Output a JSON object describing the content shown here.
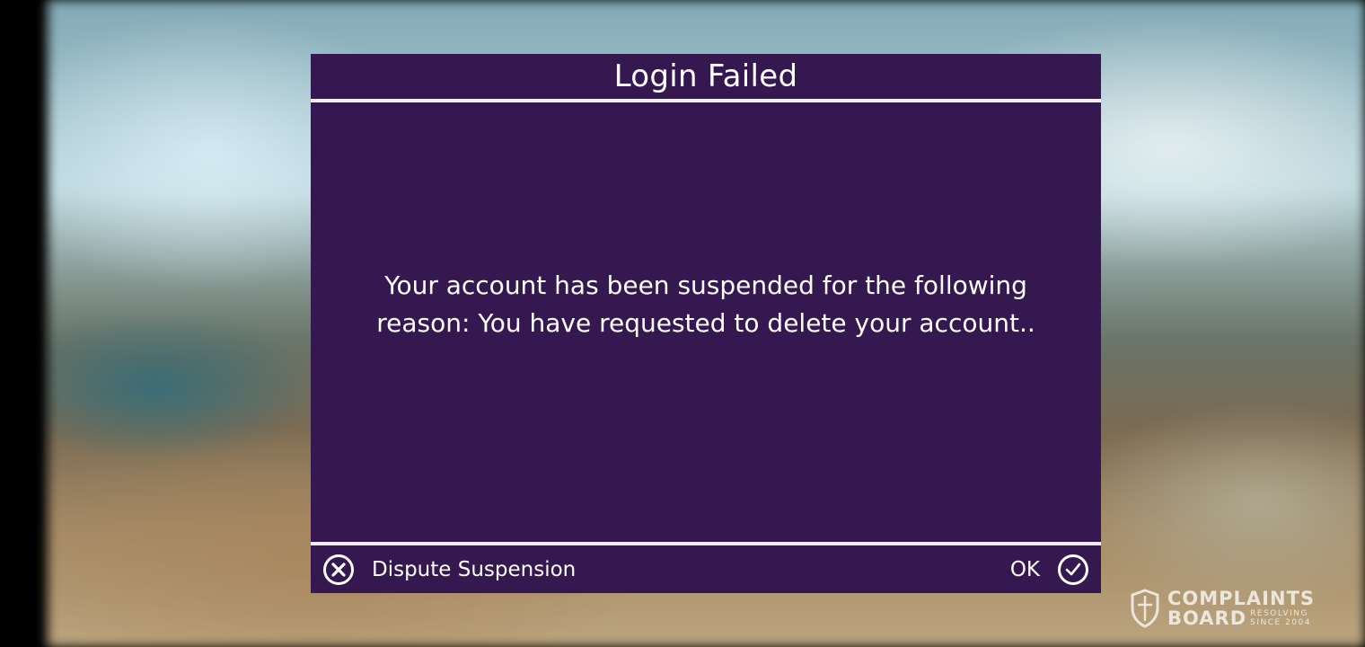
{
  "dialog": {
    "title": "Login Failed",
    "message": "Your account has been suspended for the following reason: You have requested to delete your account..",
    "buttons": {
      "dispute_label": "Dispute Suspension",
      "dispute_icon": "circle-x-icon",
      "ok_label": "OK",
      "ok_icon": "circle-check-icon"
    },
    "colors": {
      "background": "#34184f",
      "divider": "#f3eef5",
      "text": "#ffffff"
    }
  },
  "watermark": {
    "line1": "COMPLAINTS",
    "line2": "BOARD",
    "tag1": "RESOLVING",
    "tag2": "SINCE 2004",
    "icon": "shield-icon"
  }
}
